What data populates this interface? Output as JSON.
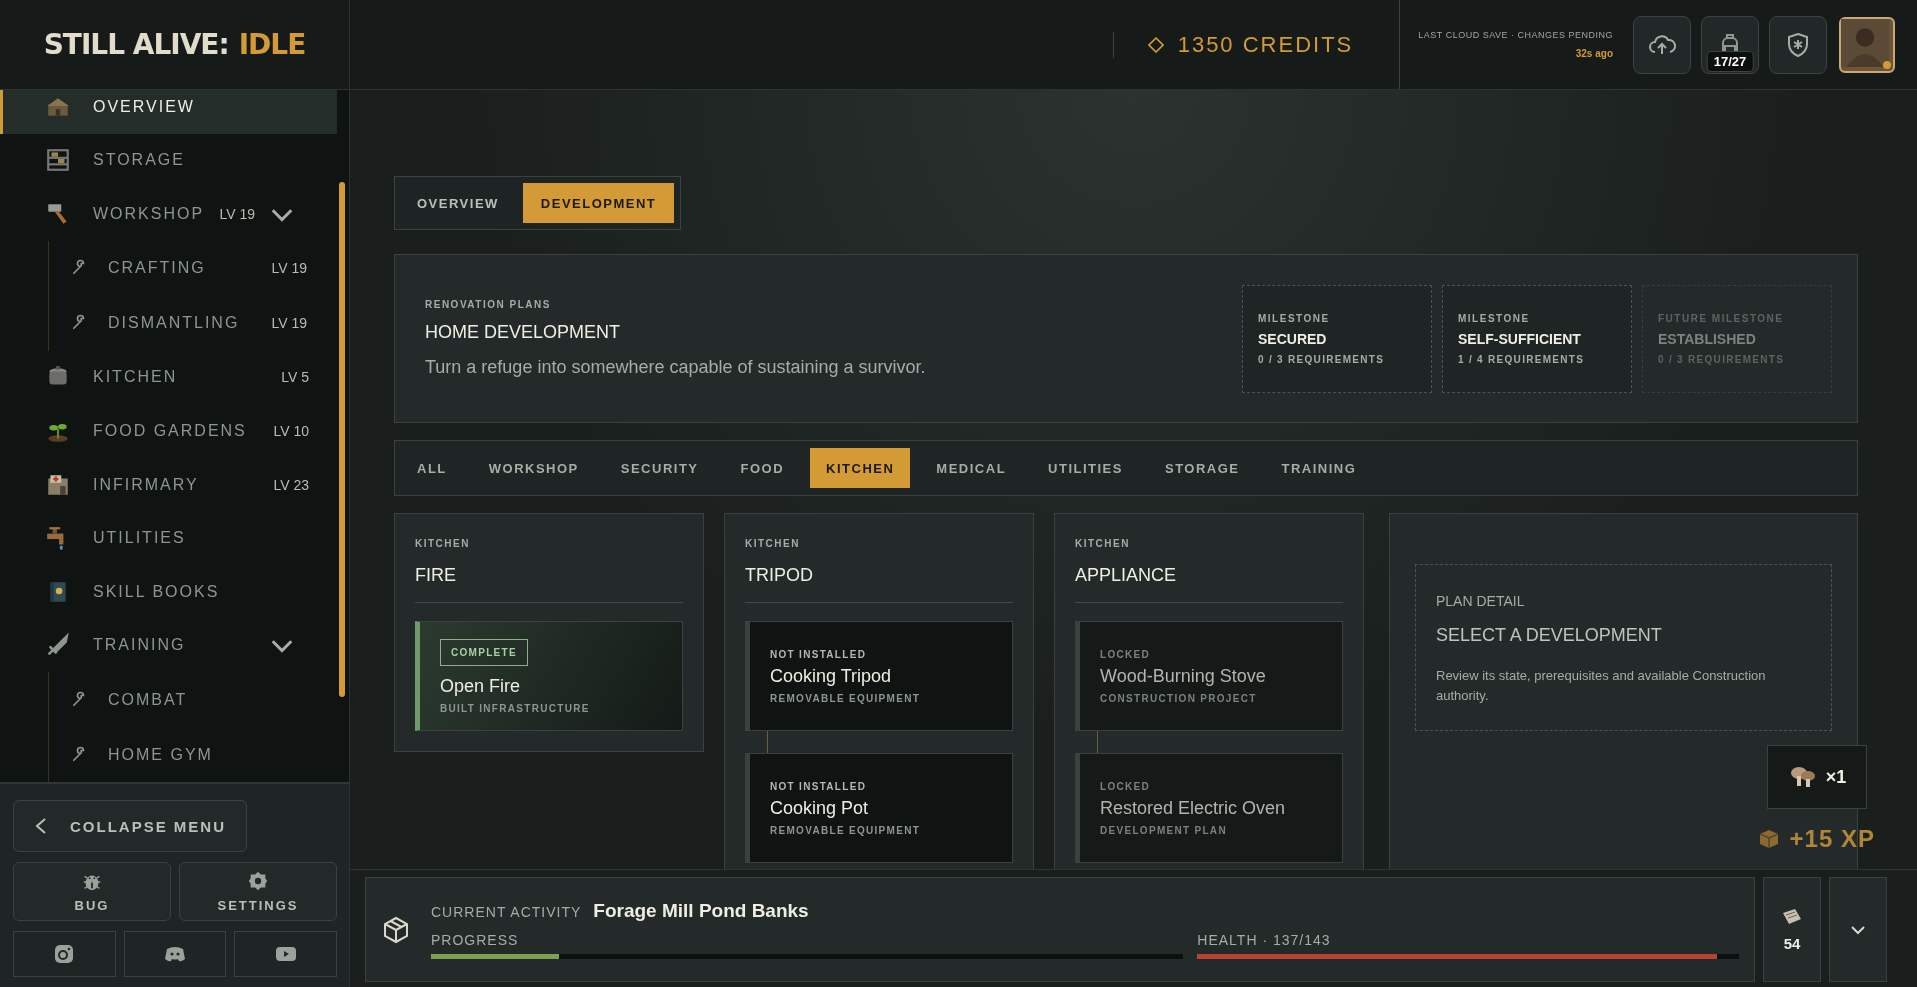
{
  "logo": {
    "text": "STILL ALIVE:",
    "accent": "IDLE"
  },
  "sidebar": {
    "items": [
      {
        "label": "OVERVIEW",
        "selected": true
      },
      {
        "label": "STORAGE",
        "selected": false
      },
      {
        "label": "WORKSHOP",
        "lv": "LV 19",
        "selected": false,
        "expanded": true,
        "children": [
          {
            "label": "CRAFTING",
            "lv": "LV 19",
            "selected": false
          },
          {
            "label": "DISMANTLING",
            "lv": "LV 19",
            "selected": false
          }
        ]
      },
      {
        "label": "KITCHEN",
        "lv": "LV 5",
        "selected": false
      },
      {
        "label": "FOOD GARDENS",
        "lv": "LV 10",
        "selected": false
      },
      {
        "label": "INFIRMARY",
        "lv": "LV 23",
        "selected": false
      },
      {
        "label": "UTILITIES",
        "selected": false
      },
      {
        "label": "SKILL BOOKS",
        "selected": false
      },
      {
        "label": "TRAINING",
        "selected": false,
        "expanded": true,
        "children": [
          {
            "label": "COMBAT",
            "selected": false
          },
          {
            "label": "HOME GYM",
            "selected": false
          }
        ]
      }
    ],
    "collapse_button": "COLLAPSE MENU",
    "tool_buttons": [
      "BUG",
      "SETTINGS"
    ]
  },
  "topbar": {
    "credits": "1350 CREDITS",
    "save_status": "LAST CLOUD SAVE · CHANGES PENDING",
    "save_time": "32s ago",
    "backpack_count": "17/27"
  },
  "view_tabs": [
    {
      "label": "OVERVIEW",
      "selected": false
    },
    {
      "label": "DEVELOPMENT",
      "selected": true
    }
  ],
  "plans": {
    "eyebrow": "RENOVATION PLANS",
    "title": "HOME DEVELOPMENT",
    "description": "Turn a refuge into somewhere capable of sustaining a survivor.",
    "milestones": [
      {
        "eyebrow": "MILESTONE",
        "name": "SECURED",
        "requirements": "0 / 3 REQUIREMENTS",
        "future": false
      },
      {
        "eyebrow": "MILESTONE",
        "name": "SELF-SUFFICIENT",
        "requirements": "1 / 4 REQUIREMENTS",
        "future": false
      },
      {
        "eyebrow": "FUTURE MILESTONE",
        "name": "ESTABLISHED",
        "requirements": "0 / 3 REQUIREMENTS",
        "future": true
      }
    ]
  },
  "filter_tabs": [
    {
      "label": "ALL",
      "selected": false
    },
    {
      "label": "WORKSHOP",
      "selected": false
    },
    {
      "label": "SECURITY",
      "selected": false
    },
    {
      "label": "FOOD",
      "selected": false
    },
    {
      "label": "KITCHEN",
      "selected": true
    },
    {
      "label": "MEDICAL",
      "selected": false
    },
    {
      "label": "UTILITIES",
      "selected": false
    },
    {
      "label": "STORAGE",
      "selected": false
    },
    {
      "label": "TRAINING",
      "selected": false
    }
  ],
  "columns": [
    {
      "category": "KITCHEN",
      "title": "FIRE",
      "items": [
        {
          "kind": "complete",
          "status": "COMPLETE",
          "name": "Open Fire",
          "type": "BUILT INFRASTRUCTURE"
        }
      ]
    },
    {
      "category": "KITCHEN",
      "title": "TRIPOD",
      "items": [
        {
          "kind": "not_installed",
          "status": "NOT INSTALLED",
          "name": "Cooking Tripod",
          "type": "REMOVABLE EQUIPMENT"
        },
        {
          "kind": "not_installed",
          "status": "NOT INSTALLED",
          "name": "Cooking Pot",
          "type": "REMOVABLE EQUIPMENT"
        }
      ]
    },
    {
      "category": "KITCHEN",
      "title": "APPLIANCE",
      "items": [
        {
          "kind": "locked",
          "status": "LOCKED",
          "name": "Wood-Burning Stove",
          "type": "CONSTRUCTION PROJECT"
        },
        {
          "kind": "locked",
          "status": "LOCKED",
          "name": "Restored Electric Oven",
          "type": "DEVELOPMENT PLAN"
        }
      ]
    }
  ],
  "plan_detail": {
    "eyebrow": "PLAN DETAIL",
    "title": "SELECT A DEVELOPMENT",
    "description": "Review its state, prerequisites and available Construction authority."
  },
  "toast": {
    "count": "×1"
  },
  "xp_popup": "+15 XP",
  "activity": {
    "label": "CURRENT ACTIVITY",
    "name": "Forage Mill Pond Banks",
    "progress_label": "PROGRESS",
    "progress": {
      "level": 0.17
    },
    "health_label": "HEALTH · 137/143",
    "health": {
      "level": 0.96
    },
    "item_count": "54"
  }
}
